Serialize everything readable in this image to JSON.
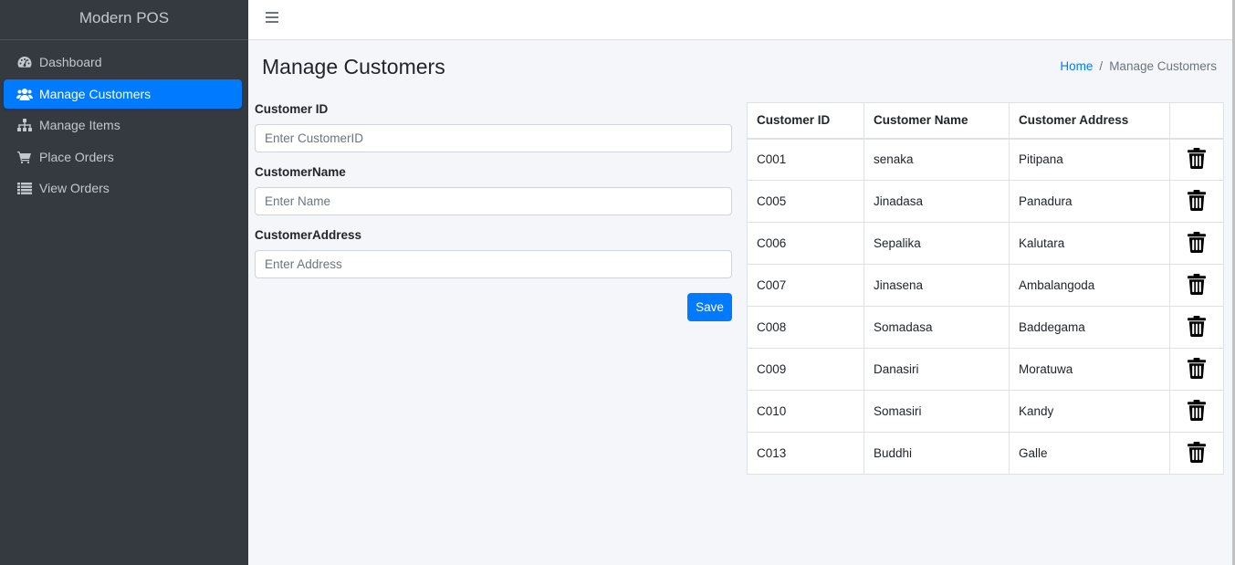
{
  "brand": "Modern POS",
  "nav": [
    {
      "label": "Dashboard",
      "icon": "dashboard-icon",
      "active": false
    },
    {
      "label": "Manage Customers",
      "icon": "users-icon",
      "active": true
    },
    {
      "label": "Manage Items",
      "icon": "sitemap-icon",
      "active": false
    },
    {
      "label": "Place Orders",
      "icon": "cart-icon",
      "active": false
    },
    {
      "label": "View Orders",
      "icon": "list-icon",
      "active": false
    }
  ],
  "page": {
    "title": "Manage Customers",
    "breadcrumb": {
      "home": "Home",
      "separator": "/",
      "current": "Manage Customers"
    }
  },
  "form": {
    "id_label": "Customer ID",
    "id_placeholder": "Enter CustomerID",
    "name_label": "CustomerName",
    "name_placeholder": "Enter Name",
    "address_label": "CustomerAddress",
    "address_placeholder": "Enter Address",
    "save_label": "Save"
  },
  "table": {
    "headers": [
      "Customer ID",
      "Customer Name",
      "Customer Address",
      ""
    ],
    "rows": [
      [
        "C001",
        "senaka",
        "Pitipana"
      ],
      [
        "C005",
        "Jinadasa",
        "Panadura"
      ],
      [
        "C006",
        "Sepalika",
        "Kalutara"
      ],
      [
        "C007",
        "Jinasena",
        "Ambalangoda"
      ],
      [
        "C008",
        "Somadasa",
        "Baddegama"
      ],
      [
        "C009",
        "Danasiri",
        "Moratuwa"
      ],
      [
        "C010",
        "Somasiri",
        "Kandy"
      ],
      [
        "C013",
        "Buddhi",
        "Galle"
      ]
    ]
  },
  "colors": {
    "accent": "#007bff",
    "sidebar": "#343a40",
    "background": "#f4f6f9"
  }
}
